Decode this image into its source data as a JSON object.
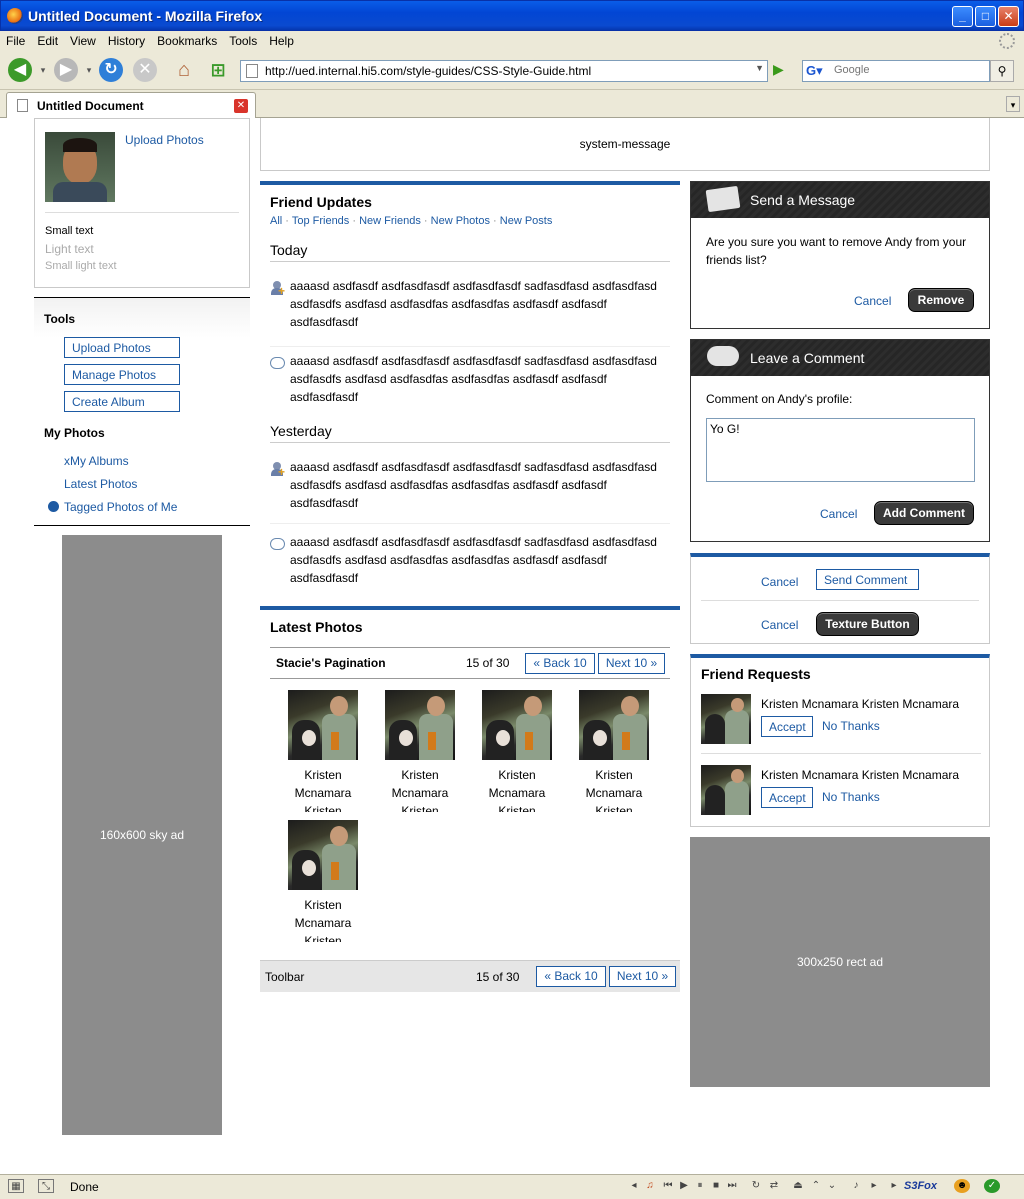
{
  "window": {
    "title": "Untitled Document - Mozilla Firefox",
    "menu": [
      "File",
      "Edit",
      "View",
      "History",
      "Bookmarks",
      "Tools",
      "Help"
    ],
    "url": "http://ued.internal.hi5.com/style-guides/CSS-Style-Guide.html",
    "search_placeholder": "Google",
    "tab_title": "Untitled Document",
    "status": "Done",
    "status_addon": "S3Fox"
  },
  "left": {
    "upload_photos_link": "Upload Photos",
    "small_text": "Small text",
    "light_text": "Light text",
    "small_light_text": "Small light text",
    "tools_title": "Tools",
    "tool_buttons": [
      "Upload Photos",
      "Manage Photos",
      "Create Album"
    ],
    "my_photos_title": "My Photos",
    "my_photos_links": [
      "xMy Albums",
      "Latest Photos",
      "Tagged Photos of Me"
    ],
    "sky_ad": "160x600 sky ad"
  },
  "center": {
    "system_message": "system-message",
    "friend_updates_title": "Friend Updates",
    "filters": [
      "All",
      "Top Friends",
      "New Friends",
      "New Photos",
      "New Posts"
    ],
    "today_label": "Today",
    "yesterday_label": "Yesterday",
    "feed_text": "aaaasd asdfasdf asdfasdfasdf asdfasdfasdf sadfasdfasd asdfasdfasd asdfasdfs asdfasd asdfasdfas asdfasdfas asdfasdf asdfasdf asdfasdfasdf",
    "latest_photos_title": "Latest Photos",
    "pagination_label": "Stacie's Pagination",
    "page_count": "15 of 30",
    "back_label": "« Back 10",
    "next_label": "Next 10 »",
    "photo_caption": "Kristen Mcnamara",
    "photo_caption_overflow": "Kristen",
    "toolbar_label": "Toolbar"
  },
  "right": {
    "send_message_title": "Send a Message",
    "remove_question": "Are you sure you want to remove Andy from your friends list?",
    "cancel": "Cancel",
    "remove": "Remove",
    "leave_comment_title": "Leave a Comment",
    "comment_label": "Comment on Andy's profile:",
    "comment_value": "Yo G!",
    "add_comment": "Add Comment",
    "send_comment": "Send Comment",
    "texture_button": "Texture Button",
    "friend_requests_title": "Friend Requests",
    "requester_name": "Kristen Mcnamara Kristen Mcnamara",
    "accept": "Accept",
    "no_thanks": "No Thanks",
    "rect_ad": "300x250 rect ad"
  },
  "colors": {
    "link": "#1d5aa3",
    "accent_bar": "#1d5aa3",
    "dark_button": "#3a3a3a",
    "ad_gray": "#8c8c8c"
  }
}
